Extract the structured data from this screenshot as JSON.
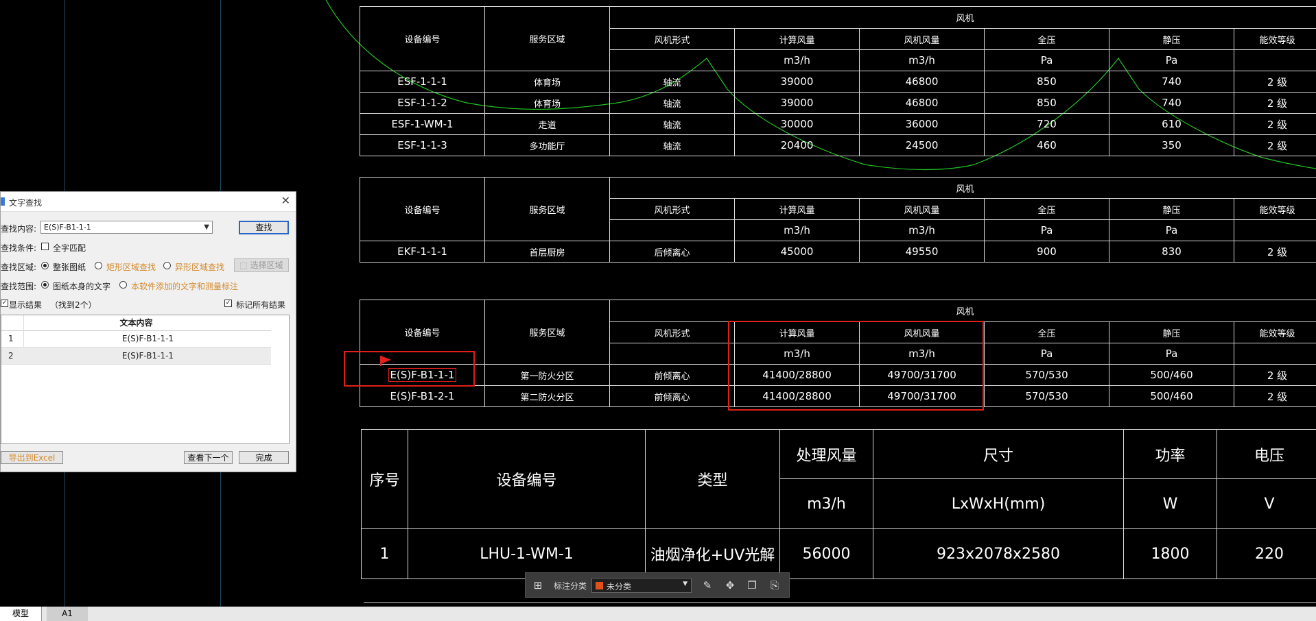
{
  "tables": [
    {
      "header": {
        "device_no": "设备编号",
        "service_area": "服务区域",
        "fan": "风机",
        "fan_type": "风机形式",
        "calc_air": "计算风量",
        "fan_air": "风机风量",
        "total_press": "全压",
        "static_press": "静压",
        "efficiency": "能效等级"
      },
      "units": {
        "calc_air": "m3/h",
        "fan_air": "m3/h",
        "total_press": "Pa",
        "static_press": "Pa"
      },
      "rows": [
        {
          "id": "ESF-1-1-1",
          "area": "体育场",
          "type": "轴流",
          "calc": "39000",
          "fan": "46800",
          "total": "850",
          "static": "740",
          "eff": "2 级"
        },
        {
          "id": "ESF-1-1-2",
          "area": "体育场",
          "type": "轴流",
          "calc": "39000",
          "fan": "46800",
          "total": "850",
          "static": "740",
          "eff": "2 级"
        },
        {
          "id": "ESF-1-WM-1",
          "area": "走道",
          "type": "轴流",
          "calc": "30000",
          "fan": "36000",
          "total": "720",
          "static": "610",
          "eff": "2 级"
        },
        {
          "id": "ESF-1-1-3",
          "area": "多功能厅",
          "type": "轴流",
          "calc": "20400",
          "fan": "24500",
          "total": "460",
          "static": "350",
          "eff": "2 级"
        }
      ]
    },
    {
      "header": {
        "device_no": "设备编号",
        "service_area": "服务区域",
        "fan": "风机",
        "fan_type": "风机形式",
        "calc_air": "计算风量",
        "fan_air": "风机风量",
        "total_press": "全压",
        "static_press": "静压",
        "efficiency": "能效等级"
      },
      "units": {
        "calc_air": "m3/h",
        "fan_air": "m3/h",
        "total_press": "Pa",
        "static_press": "Pa"
      },
      "rows": [
        {
          "id": "EKF-1-1-1",
          "area": "首层厨房",
          "type": "后倾离心",
          "calc": "45000",
          "fan": "49550",
          "total": "900",
          "static": "830",
          "eff": "2 级"
        }
      ]
    },
    {
      "header": {
        "device_no": "设备编号",
        "service_area": "服务区域",
        "fan": "风机",
        "fan_type": "风机形式",
        "calc_air": "计算风量",
        "fan_air": "风机风量",
        "total_press": "全压",
        "static_press": "静压",
        "efficiency": "能效等级"
      },
      "units": {
        "calc_air": "m3/h",
        "fan_air": "m3/h",
        "total_press": "Pa",
        "static_press": "Pa"
      },
      "rows": [
        {
          "id": "E(S)F-B1-1-1",
          "area": "第一防火分区",
          "type": "前倾离心",
          "calc": "41400/28800",
          "fan": "49700/31700",
          "total": "570/530",
          "static": "500/460",
          "eff": "2 级"
        },
        {
          "id": "E(S)F-B1-2-1",
          "area": "第二防火分区",
          "type": "前倾离心",
          "calc": "41400/28800",
          "fan": "49700/31700",
          "total": "570/530",
          "static": "500/460",
          "eff": "2 级"
        }
      ]
    }
  ],
  "equip_table": {
    "header": {
      "seq": "序号",
      "device_no": "设备编号",
      "type": "类型",
      "air": "处理风量",
      "size": "尺寸",
      "power": "功率",
      "voltage": "电压"
    },
    "units": {
      "air": "m3/h",
      "size": "LxWxH(mm)",
      "power": "W",
      "voltage": "V"
    },
    "row": {
      "seq": "1",
      "device_no": "LHU-1-WM-1",
      "type": "油烟净化+UV光解",
      "air": "56000",
      "size": "923x2078x2580",
      "power": "1800",
      "voltage": "220"
    }
  },
  "dialog": {
    "title": "文字查找",
    "close": "✕",
    "find_label": "查找内容:",
    "find_value": "E(S)F-B1-1-1",
    "find_button": "查找",
    "cond_label": "查找条件:",
    "whole_word": "全字匹配",
    "area_label": "查找区域:",
    "area_opt1": "整张图纸",
    "area_opt2": "矩形区域查找",
    "area_opt3": "异形区域查找",
    "select_area_button": "选择区域",
    "scope_label": "查找范围:",
    "scope_opt1": "图纸本身的文字",
    "scope_opt2": "本软件添加的文字和测量标注",
    "show_results": "显示结果",
    "found_count": "（找到2个）",
    "mark_all": "标记所有结果",
    "col_header": "文本内容",
    "results": [
      {
        "n": "1",
        "text": "E(S)F-B1-1-1"
      },
      {
        "n": "2",
        "text": "E(S)F-B1-1-1"
      }
    ],
    "export_button": "导出到Excel",
    "next_button": "查看下一个",
    "done_button": "完成"
  },
  "toolbar": {
    "label": "标注分类",
    "category": "未分类",
    "swatch_color": "#e0501a"
  },
  "status_tabs": {
    "model": "模型",
    "layout": "A1"
  }
}
